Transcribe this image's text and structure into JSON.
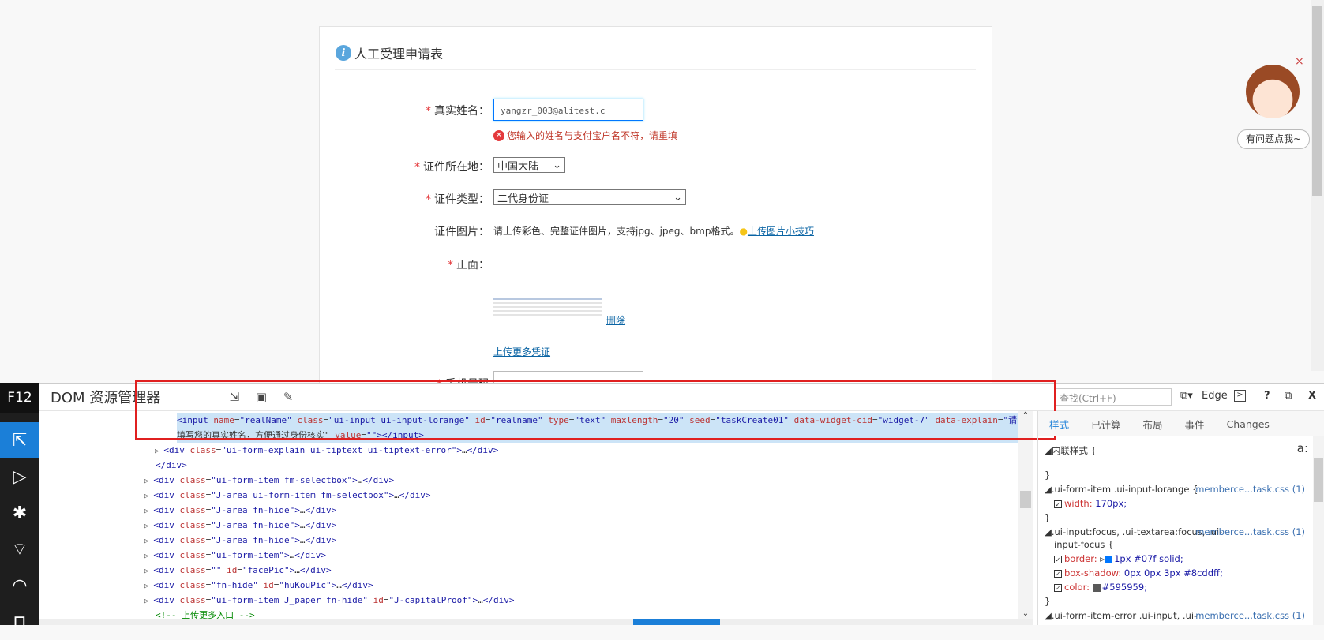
{
  "form": {
    "title": "人工受理申请表",
    "icon": "info-icon",
    "fields": {
      "real_name": {
        "label": "真实姓名：",
        "value": "yangzr_003@alitest.c",
        "error": "您输入的姓名与支付宝户名不符，请重填"
      },
      "id_region": {
        "label": "证件所在地：",
        "selected": "中国大陆"
      },
      "id_type": {
        "label": "证件类型：",
        "selected": "二代身份证"
      },
      "id_image": {
        "label": "证件图片：",
        "hint": "请上传彩色、完整证件图片，支持jpg、jpeg、bmp格式。",
        "tip_link": "上传图片小技巧"
      },
      "front": {
        "label": "正面：",
        "delete_link": "删除"
      },
      "more_link": "上传更多凭证",
      "phone": {
        "label": "手机号码"
      }
    },
    "required_mark": "*"
  },
  "helper": {
    "bubble": "有问题点我~",
    "close": "×"
  },
  "devtools": {
    "f12": "F12",
    "title": "DOM 资源管理器",
    "find_placeholder": "查找(Ctrl+F)",
    "mode": "Edge",
    "help": "?",
    "close": "X",
    "highlight_color": "#e02020",
    "dom_lines": [
      {
        "indent": 2,
        "selected": true,
        "html": "<input name=\"realName\" class=\"ui-input ui-input-lorange\" id=\"realname\" type=\"text\" maxlength=\"20\" seed=\"taskCreate01\" data-widget-cid=\"widget-7\" data-explain=\"请"
      },
      {
        "indent": 2,
        "selected": true,
        "html": "填写您的真实姓名，方便通过身份核实\" value=\"\"></input>"
      },
      {
        "indent": 2,
        "arrow": true,
        "html": "<div class=\"ui-form-explain ui-tiptext ui-tiptext-error\">…</div>"
      },
      {
        "indent": 1,
        "html": "</div>"
      },
      {
        "indent": 1,
        "arrow": true,
        "html": "<div class=\"ui-form-item fm-selectbox\">…</div>"
      },
      {
        "indent": 1,
        "arrow": true,
        "html": "<div class=\"J-area ui-form-item fm-selectbox\">…</div>"
      },
      {
        "indent": 1,
        "arrow": true,
        "html": "<div class=\"J-area fn-hide\">…</div>"
      },
      {
        "indent": 1,
        "arrow": true,
        "html": "<div class=\"J-area fn-hide\">…</div>"
      },
      {
        "indent": 1,
        "arrow": true,
        "html": "<div class=\"J-area fn-hide\">…</div>"
      },
      {
        "indent": 1,
        "arrow": true,
        "html": "<div class=\"ui-form-item\">…</div>"
      },
      {
        "indent": 1,
        "arrow": true,
        "html": "<div class=\"\" id=\"facePic\">…</div>"
      },
      {
        "indent": 1,
        "arrow": true,
        "html": "<div class=\"fn-hide\" id=\"huKouPic\">…</div>"
      },
      {
        "indent": 1,
        "arrow": true,
        "html": "<div class=\"ui-form-item J_paper fn-hide\" id=\"J-capitalProof\">…</div>"
      },
      {
        "indent": 1,
        "comment": true,
        "html": "<!-- 上传更多入口 -->"
      }
    ],
    "style_tabs": [
      "样式",
      "已计算",
      "布局",
      "事件",
      "Changes"
    ],
    "styles": {
      "inline": "内联样式  {",
      "close_brace": "}",
      "rule1": {
        "selector": ".ui-form-item .ui-input-lorange  {",
        "source": "memberce...task.css (1)",
        "props": [
          {
            "name": "width:",
            "value": "170px;"
          }
        ]
      },
      "rule2": {
        "selector": ".ui-input:focus, .ui-textarea:focus, .ui-",
        "selector2": "input-focus  {",
        "source": "memberce...task.css (1)",
        "props": [
          {
            "name": "border:",
            "value": "1px #07f solid;",
            "swatch": "#0077ff"
          },
          {
            "name": "box-shadow:",
            "value": "0px 0px 3px #8cddff;"
          },
          {
            "name": "color:",
            "value": "#595959;",
            "swatch": "#595959"
          }
        ]
      },
      "rule3": {
        "selector": ".ui-form-item-error .ui-input, .ui-",
        "source": "memberce...task.css (1)"
      }
    }
  }
}
